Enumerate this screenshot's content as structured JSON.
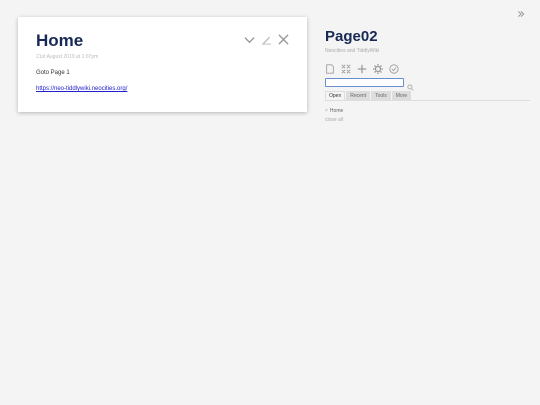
{
  "tiddler": {
    "title": "Home",
    "subtitle": "21st August 2019 at 1:07pm",
    "text": "Goto Page 1",
    "link": "https://neo-tiddlywiki.neocities.org/"
  },
  "site": {
    "title": "Page02",
    "subtitle": "Neocities and TiddlyWiki"
  },
  "search": {
    "value": "",
    "placeholder": ""
  },
  "tabs": [
    {
      "label": "Open",
      "active": true
    },
    {
      "label": "Recent",
      "active": false
    },
    {
      "label": "Tools",
      "active": false
    },
    {
      "label": "More",
      "active": false
    }
  ],
  "open_list": {
    "items": [
      {
        "label": "Home"
      }
    ],
    "close_all": "close all"
  },
  "icons": {
    "tiddler_controls": [
      "chevron-down-icon",
      "edit-icon",
      "close-icon"
    ],
    "page_controls": [
      "new-tiddler-icon",
      "close-all-icon",
      "plus-icon",
      "gear-icon",
      "check-icon"
    ],
    "search": "search-icon",
    "sidebar_toggle": "double-chevron-right-icon"
  },
  "colors": {
    "title": "#182955",
    "background": "#f4f4f4",
    "link": "#2222cc",
    "icon": "#999999"
  }
}
